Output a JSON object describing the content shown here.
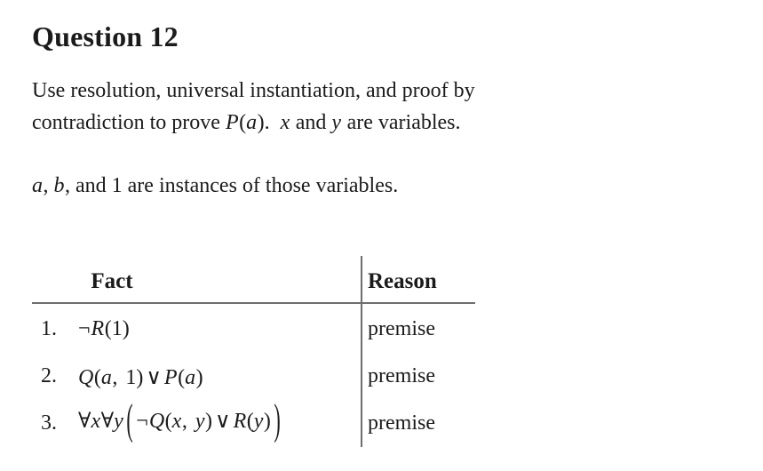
{
  "document": {
    "title": "Question 12",
    "paragraphs": [
      {
        "id": "para1",
        "line1_pre": "Use resolution, universal instantiation, and proof by",
        "line2_pre": "contradiction to prove ",
        "line2_p": "P",
        "line2_paren_open": "(",
        "line2_a": "a",
        "line2_paren_close": ")",
        "line2_mid": ".",
        "line2_x": "x",
        "line2_and": " and ",
        "line2_y": "y",
        "line2_post": " are variables."
      },
      {
        "id": "para2",
        "a": "a",
        "sep1": ", ",
        "b": "b",
        "sep2": ", and ",
        "one": "1",
        "post": " are instances of those variables."
      }
    ],
    "table": {
      "headers": {
        "fact": "Fact",
        "reason": "Reason"
      },
      "rows": [
        {
          "number": "1.",
          "fact_parts": {
            "neg": "¬",
            "pred": "R",
            "open": "(",
            "arg1": "1",
            "close": ")"
          },
          "reason": "premise"
        },
        {
          "number": "2.",
          "fact_parts": {
            "pred1": "Q",
            "open1": "(",
            "arg1": "a",
            "comma": ", ",
            "arg2": "1",
            "close1": ")",
            "operator": "∨",
            "pred2": "P",
            "open2": "(",
            "arg3": "a",
            "close2": ")"
          },
          "reason": "premise"
        },
        {
          "number": "3.",
          "fact_parts": {
            "forall1": "∀",
            "var1": "x",
            "forall2": "∀",
            "var2": "y",
            "bigopen": "(",
            "neg": "¬",
            "pred1": "Q",
            "open1": "(",
            "arg1": "x",
            "comma": ", ",
            "arg2": "y",
            "close1": ")",
            "operator": "∨",
            "pred2": "R",
            "open2": "(",
            "arg3": "y",
            "close2": ")",
            "bigclose": ")"
          },
          "reason": "premise"
        }
      ]
    }
  },
  "colors": {
    "text": "#1b1b1b",
    "rule": "#6e6e6e",
    "background": "#ffffff"
  }
}
